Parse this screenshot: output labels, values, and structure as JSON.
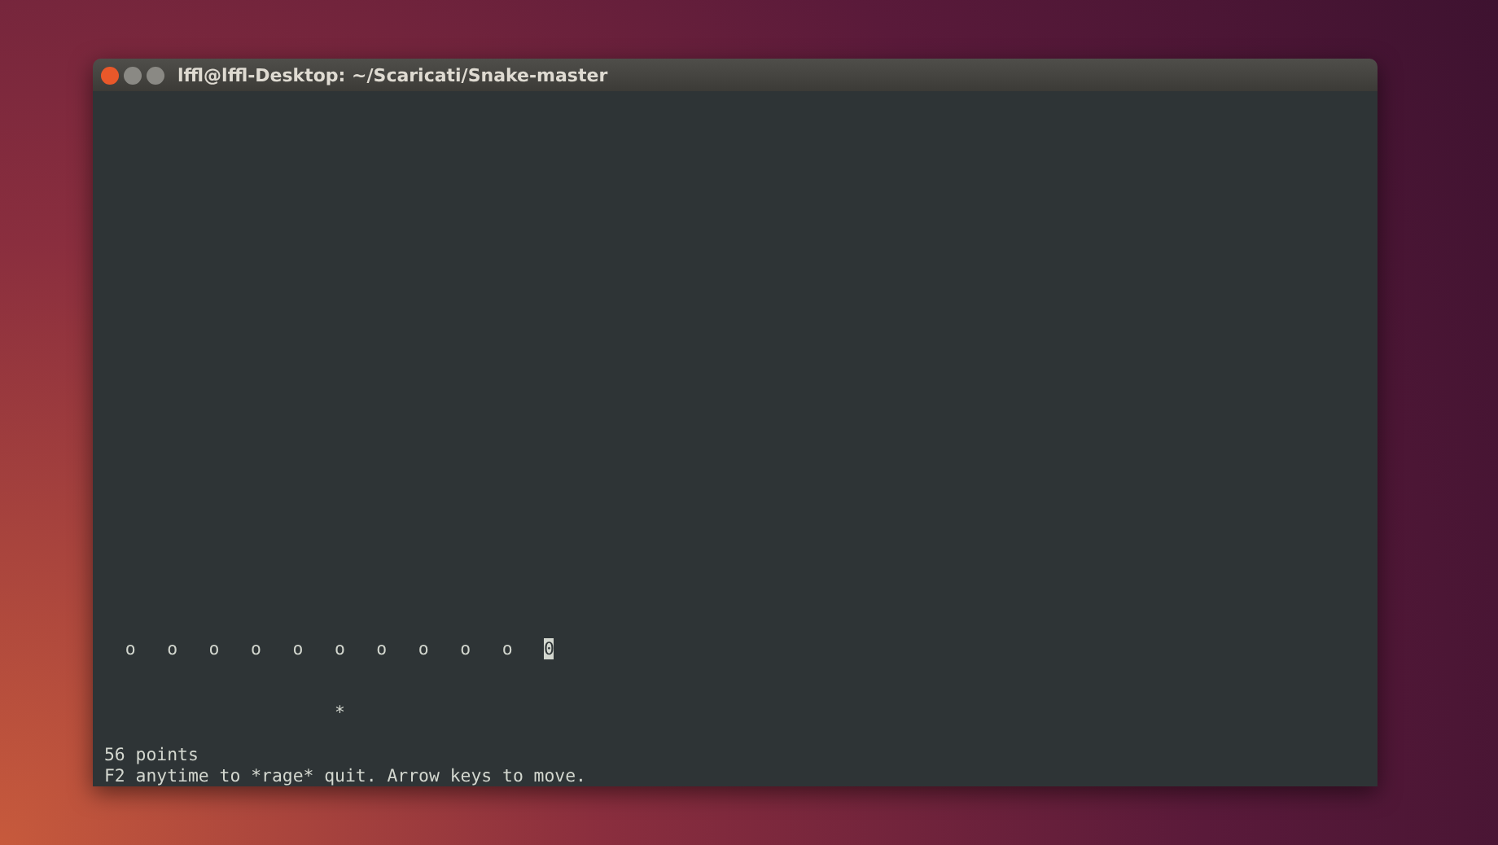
{
  "window": {
    "title": "lffl@lffl-Desktop: ~/Scaricati/Snake-master"
  },
  "terminal": {
    "snake": [
      {
        "text": "o",
        "cursor": false
      },
      {
        "text": "o",
        "cursor": false
      },
      {
        "text": "o",
        "cursor": false
      },
      {
        "text": "o",
        "cursor": false
      },
      {
        "text": "o",
        "cursor": false
      },
      {
        "text": "o",
        "cursor": false
      },
      {
        "text": "o",
        "cursor": false
      },
      {
        "text": "o",
        "cursor": false
      },
      {
        "text": "o",
        "cursor": false
      },
      {
        "text": "o",
        "cursor": false
      },
      {
        "text": "0",
        "cursor": true
      }
    ],
    "food": "*",
    "score": "56 points",
    "help": "F2 anytime to *rage* quit. Arrow keys to move."
  }
}
